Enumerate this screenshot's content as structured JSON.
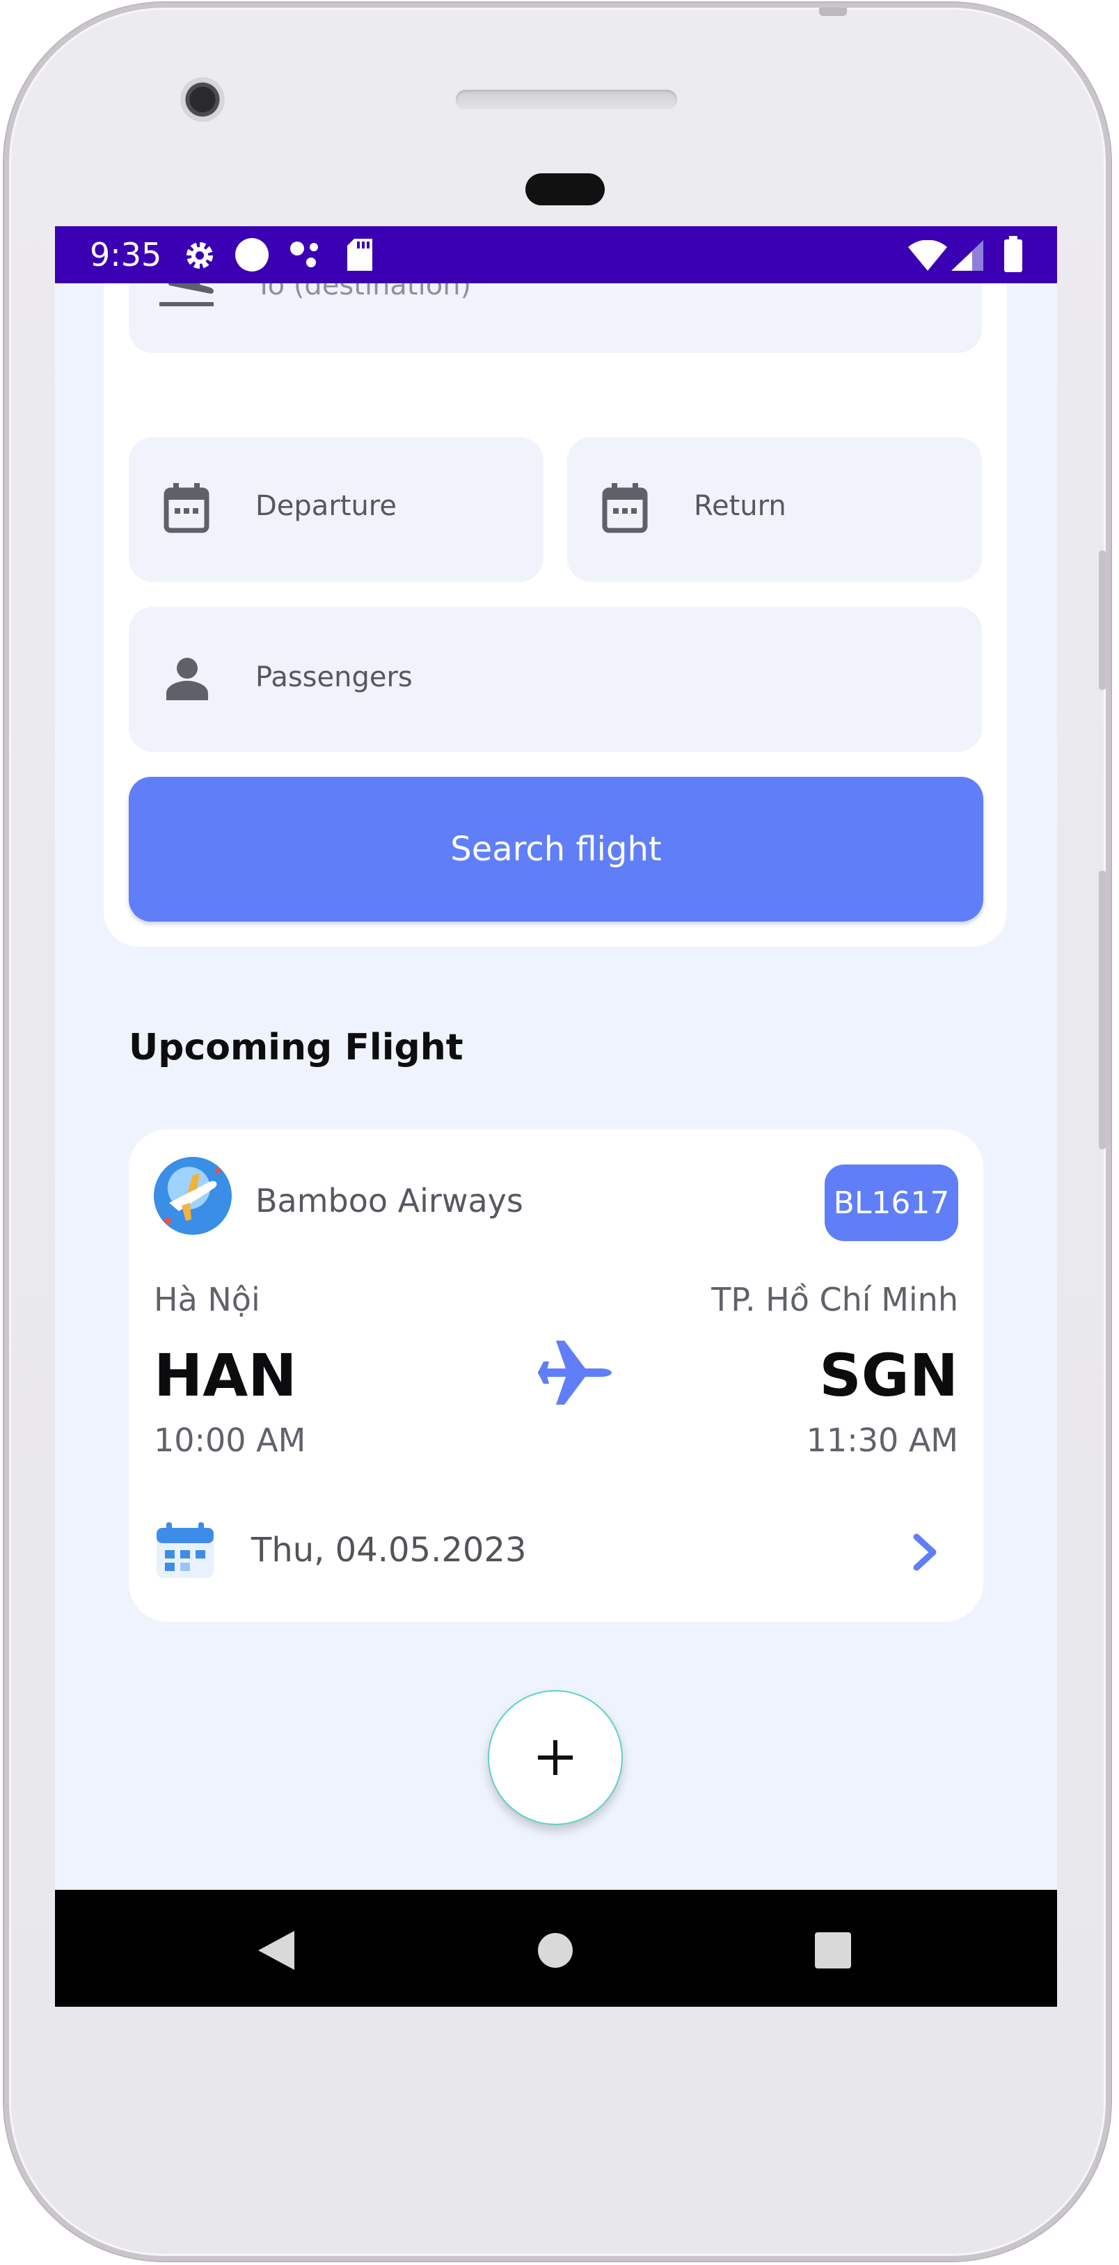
{
  "status_bar": {
    "time": "9:35",
    "icons": [
      "gear-icon",
      "circle-icon",
      "assistant-dots-icon",
      "sd-card-icon",
      "wifi-icon",
      "cell-signal-icon",
      "battery-icon"
    ]
  },
  "search_form": {
    "to_placeholder": "To (destination)",
    "departure_label": "Departure",
    "return_label": "Return",
    "passengers_label": "Passengers",
    "search_button": "Search flight"
  },
  "upcoming": {
    "title": "Upcoming Flight",
    "flight": {
      "airline": "Bamboo Airways",
      "code": "BL1617",
      "from_city": "Hà Nội",
      "from_code": "HAN",
      "from_time": "10:00 AM",
      "to_city": "TP. Hồ Chí Minh",
      "to_code": "SGN",
      "to_time": "11:30 AM",
      "date": "Thu, 04.05.2023"
    }
  },
  "fab_icon": "plus-icon",
  "navigation": [
    "back-icon",
    "home-icon",
    "recents-icon"
  ],
  "colors": {
    "status_bar": "#3b00b3",
    "accent": "#5f7ef8",
    "background": "#eff3fd",
    "field": "#f0f3fc"
  }
}
